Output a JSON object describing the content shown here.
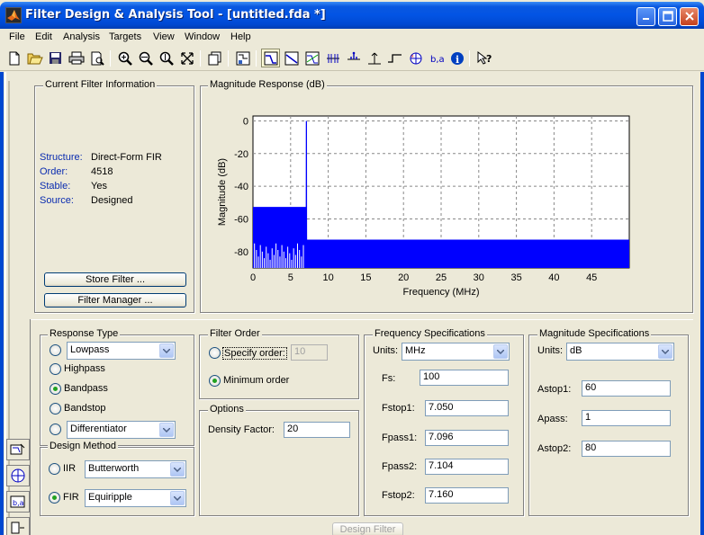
{
  "window": {
    "title": "Filter Design & Analysis Tool -  [untitled.fda *]"
  },
  "menu": [
    "File",
    "Edit",
    "Analysis",
    "Targets",
    "View",
    "Window",
    "Help"
  ],
  "current_filter": {
    "title": "Current Filter Information",
    "rows": [
      {
        "label": "Structure:",
        "value": "Direct-Form FIR"
      },
      {
        "label": "Order:",
        "value": "4518"
      },
      {
        "label": "Stable:",
        "value": "Yes"
      },
      {
        "label": "Source:",
        "value": "Designed"
      }
    ],
    "store_button": "Store Filter ...",
    "manager_button": "Filter Manager ..."
  },
  "magnitude_plot": {
    "title": "Magnitude Response (dB)"
  },
  "chart_data": {
    "type": "line",
    "title": "",
    "xlabel": "Frequency (MHz)",
    "ylabel": "Magnitude (dB)",
    "xlim": [
      0,
      50
    ],
    "ylim": [
      -90,
      3
    ],
    "x_ticks": [
      0,
      5,
      10,
      15,
      20,
      25,
      30,
      35,
      40,
      45
    ],
    "y_ticks": [
      0,
      -20,
      -40,
      -60,
      -80
    ],
    "grid": true,
    "color": "#0000ff",
    "series": [
      {
        "x": [
          0,
          7.05,
          7.05,
          7.08,
          7.09,
          7.096,
          7.1,
          7.104,
          7.11,
          7.12,
          7.16,
          7.16,
          50
        ],
        "y": [
          -53,
          -53,
          -90,
          -70,
          -30,
          -1,
          0,
          -1,
          -30,
          -70,
          -90,
          -73,
          -73
        ]
      }
    ],
    "fill_bands": [
      {
        "x0": 0,
        "x1": 7.05,
        "y0": -90,
        "y1": -53
      },
      {
        "x0": 7.16,
        "x1": 50,
        "y0": -90,
        "y1": -73
      }
    ]
  },
  "response_type": {
    "title": "Response Type",
    "options": [
      "Lowpass",
      "Highpass",
      "Bandpass",
      "Bandstop",
      "Differentiator"
    ],
    "selected": "Bandpass"
  },
  "design_method": {
    "title": "Design Method",
    "iir_label": "IIR",
    "iir_value": "Butterworth",
    "fir_label": "FIR",
    "fir_value": "Equiripple",
    "selected": "FIR"
  },
  "filter_order": {
    "title": "Filter Order",
    "specify_label": "Specify order:",
    "specify_value": "10",
    "minimum_label": "Minimum order",
    "selected": "Minimum order"
  },
  "options": {
    "title": "Options",
    "density_label": "Density Factor:",
    "density_value": "20"
  },
  "freq_specs": {
    "title": "Frequency Specifications",
    "units_label": "Units:",
    "units_value": "MHz",
    "fields": [
      {
        "label": "Fs:",
        "value": "100"
      },
      {
        "label": "Fstop1:",
        "value": "7.050"
      },
      {
        "label": "Fpass1:",
        "value": "7.096"
      },
      {
        "label": "Fpass2:",
        "value": "7.104"
      },
      {
        "label": "Fstop2:",
        "value": "7.160"
      }
    ]
  },
  "mag_specs": {
    "title": "Magnitude Specifications",
    "units_label": "Units:",
    "units_value": "dB",
    "fields": [
      {
        "label": "Astop1:",
        "value": "60"
      },
      {
        "label": "Apass:",
        "value": "1"
      },
      {
        "label": "Astop2:",
        "value": "80"
      }
    ]
  },
  "design_button": "Design Filter",
  "icons": [
    "new-file-icon",
    "open-folder-icon",
    "save-icon",
    "print-icon",
    "print-preview-icon",
    "zoom-in-icon",
    "zoom-x-icon",
    "zoom-y-icon",
    "full-view-icon",
    "new-window-icon",
    "filter-designer-icon",
    "magnitude-response-icon",
    "phase-response-icon",
    "mag-phase-icon",
    "group-delay-icon",
    "impulse-response-icon",
    "step-response-icon",
    "pole-zero-icon",
    "coefficients-icon",
    "info-icon",
    "whats-this-icon"
  ]
}
